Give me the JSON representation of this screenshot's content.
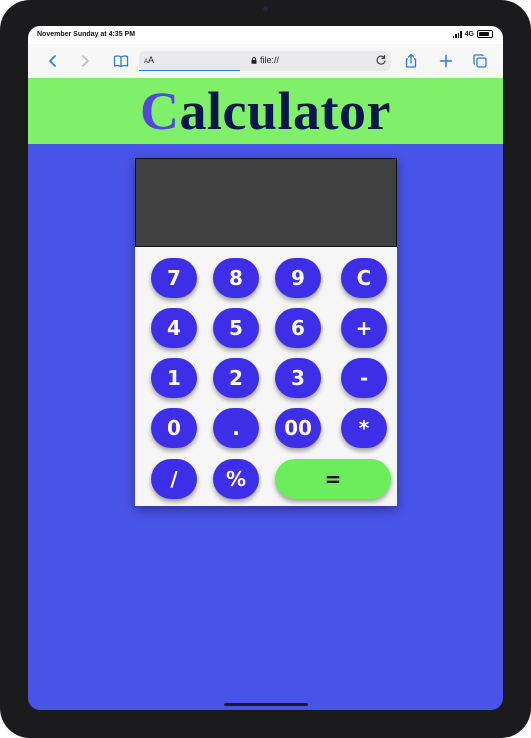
{
  "status": {
    "time": "November Sunday at 4:35 PM",
    "network": "4G"
  },
  "browser": {
    "aa_small": "A",
    "aa_large": "A",
    "url": "file://",
    "accent": "#2a7ae4"
  },
  "header": {
    "title_first": "C",
    "title_rest": "alculator",
    "bg_color": "#80f06b"
  },
  "calculator": {
    "display_value": "",
    "buttons": {
      "seven": "7",
      "eight": "8",
      "nine": "9",
      "clear": "C",
      "four": "4",
      "five": "5",
      "six": "6",
      "plus": "+",
      "one": "1",
      "two": "2",
      "three": "3",
      "minus": "-",
      "zero": "0",
      "dot": ".",
      "double_zero": "00",
      "multiply": "*",
      "divide": "/",
      "percent": "%",
      "equals": "="
    },
    "key_color": "#3e2ee8",
    "equals_color": "#6ced5c",
    "page_bg": "#4853e8"
  }
}
